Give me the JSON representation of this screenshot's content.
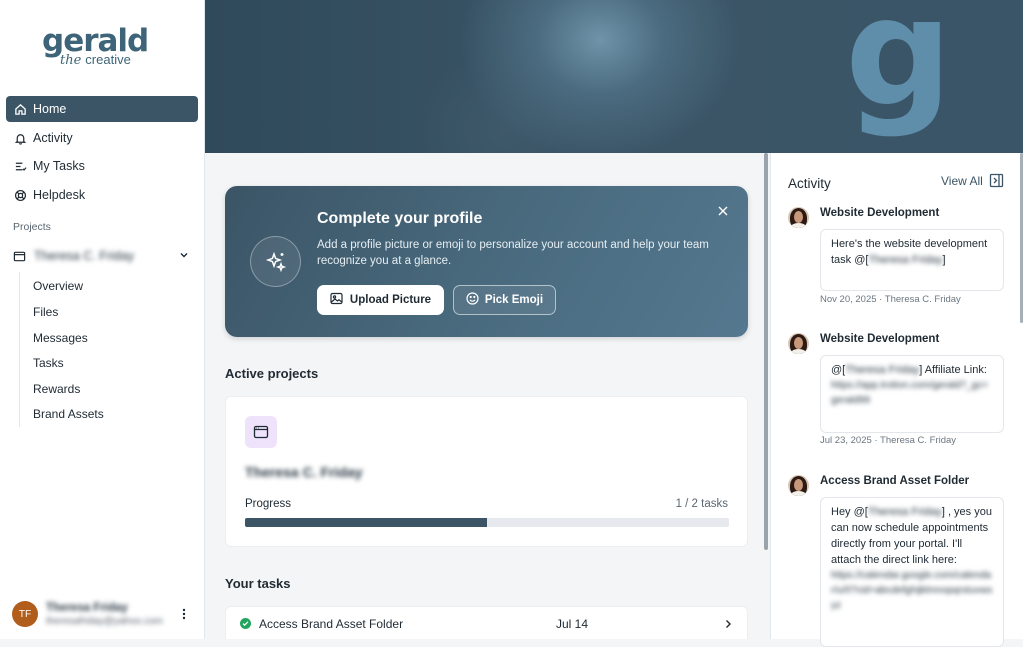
{
  "brand": {
    "name": "gerald",
    "sub_prefix": "the",
    "sub": "creative",
    "banner_glyph": "g"
  },
  "nav": [
    {
      "label": "Home",
      "icon": "home-icon",
      "active": true
    },
    {
      "label": "Activity",
      "icon": "bell-icon",
      "active": false
    },
    {
      "label": "My Tasks",
      "icon": "tasks-icon",
      "active": false
    },
    {
      "label": "Helpdesk",
      "icon": "lifebuoy-icon",
      "active": false
    }
  ],
  "projects_label": "Projects",
  "project": {
    "name": "Theresa C. Friday",
    "subitems": [
      "Overview",
      "Files",
      "Messages",
      "Tasks",
      "Rewards",
      "Brand Assets"
    ]
  },
  "user": {
    "initials": "TF",
    "name": "Theresa Friday",
    "email": "theresafriday@yahoo.com"
  },
  "profile_card": {
    "title": "Complete your profile",
    "text": "Add a profile picture or emoji to personalize your account and help your team recognize you at a glance.",
    "upload_label": "Upload Picture",
    "emoji_label": "Pick Emoji"
  },
  "active_projects": {
    "heading": "Active projects",
    "project_name": "Theresa C. Friday",
    "progress_label": "Progress",
    "progress_count": "1 / 2 tasks",
    "progress_fraction": 0.5
  },
  "your_tasks": {
    "heading": "Your tasks",
    "items": [
      {
        "name": "Access Brand Asset Folder",
        "date": "Jul 14",
        "done": true
      }
    ]
  },
  "activity": {
    "title": "Activity",
    "view_all": "View All",
    "items": [
      {
        "heading": "Website Development",
        "text_a": "Here's the website development task @[",
        "mention": "Theresa Friday",
        "text_b": "]",
        "link": "",
        "meta": "Nov 20, 2025 · Theresa C. Friday"
      },
      {
        "heading": "Website Development",
        "text_a": "@[",
        "mention": "Theresa Friday",
        "text_b": "] Affiliate Link:",
        "link": "https://app.trotion.com/gerald?_gc=gerald99",
        "meta": "Jul 23, 2025 · Theresa C. Friday"
      },
      {
        "heading": "Access Brand Asset Folder",
        "text_a": "Hey @[",
        "mention": "Theresa Friday",
        "text_b": "] , yes you can now schedule appointments directly from your portal. I'll attach the direct link here:",
        "link": "https://calendar.google.com/calendar/u/0?cid=abcdefghijklmnopqrstuvwxyz",
        "meta": ""
      }
    ]
  },
  "colors": {
    "accent": "#3b5566",
    "success": "#22a45d",
    "avatar_bg": "#b15d1c",
    "project_icon_bg": "#efe3fb"
  }
}
